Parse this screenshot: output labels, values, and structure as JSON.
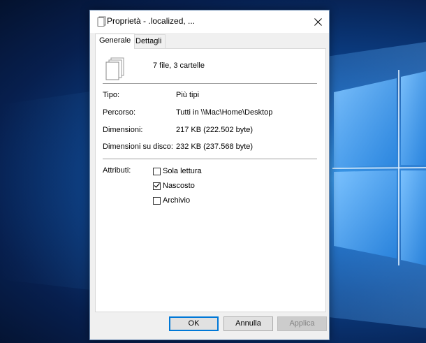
{
  "window": {
    "title": "Proprietà - .localized, ...",
    "title_icon": "documents-icon",
    "close_icon": "close-icon"
  },
  "tabs": [
    {
      "label": "Generale",
      "active": true
    },
    {
      "label": "Dettagli",
      "active": false
    }
  ],
  "summary": {
    "icon": "multiple-files-icon",
    "text": "7 file, 3 cartelle"
  },
  "properties": [
    {
      "label": "Tipo:",
      "value": "Più tipi"
    },
    {
      "label": "Percorso:",
      "value": "Tutti in \\\\Mac\\Home\\Desktop"
    },
    {
      "label": "Dimensioni:",
      "value": "217 KB (222.502 byte)"
    },
    {
      "label": "Dimensioni su disco:",
      "value": "232 KB (237.568 byte)"
    }
  ],
  "attributes": {
    "label": "Attributi:",
    "items": [
      {
        "label": "Sola lettura",
        "checked": false
      },
      {
        "label": "Nascosto",
        "checked": true
      },
      {
        "label": "Archivio",
        "checked": false
      }
    ]
  },
  "buttons": {
    "ok": "OK",
    "cancel": "Annulla",
    "apply": "Applica"
  },
  "colors": {
    "accent": "#0078d7",
    "desktop": "#0b3f86"
  }
}
